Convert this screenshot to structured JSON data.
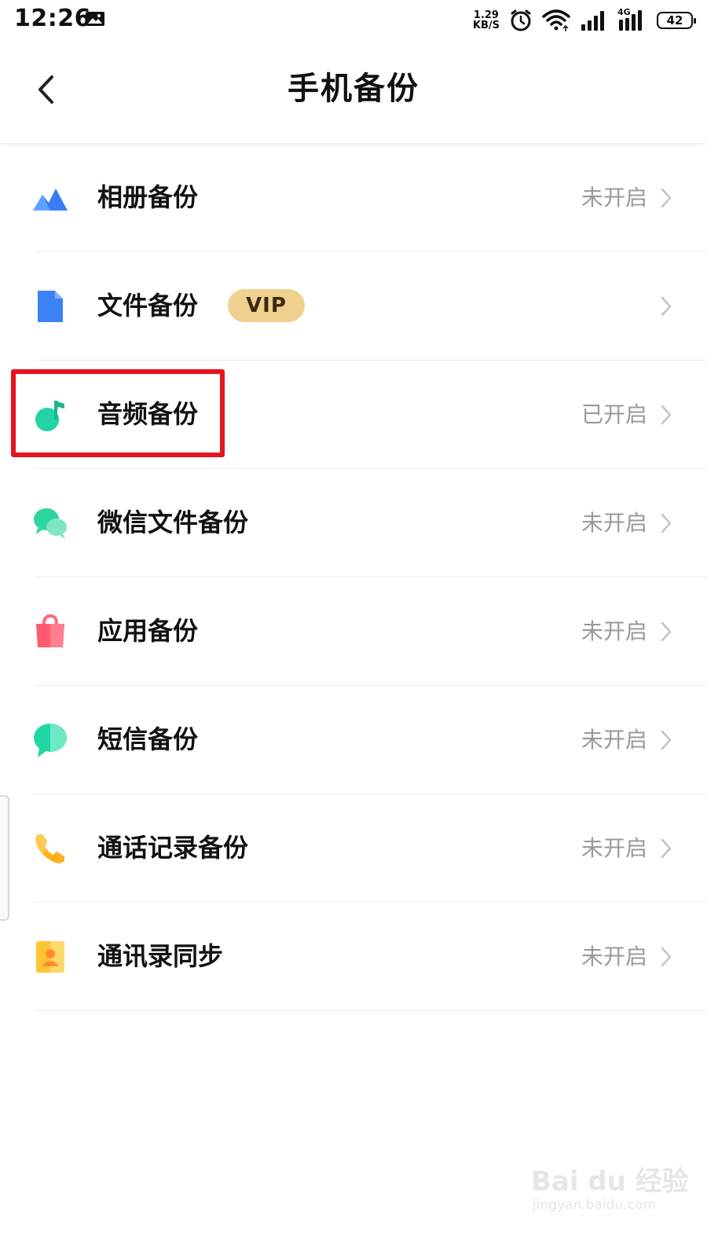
{
  "status_bar": {
    "time": "12:26",
    "net_speed_value": "1.29",
    "net_speed_unit": "KB/S",
    "signal_label": "4G",
    "battery": "42"
  },
  "header": {
    "title": "手机备份"
  },
  "list": {
    "items": [
      {
        "label": "相册备份",
        "status": "未开启",
        "icon": "photo-album-icon"
      },
      {
        "label": "文件备份",
        "status": "",
        "badge": "VIP",
        "icon": "file-icon"
      },
      {
        "label": "音频备份",
        "status": "已开启",
        "icon": "music-note-icon"
      },
      {
        "label": "微信文件备份",
        "status": "未开启",
        "icon": "wechat-icon"
      },
      {
        "label": "应用备份",
        "status": "未开启",
        "icon": "shopping-bag-icon"
      },
      {
        "label": "短信备份",
        "status": "未开启",
        "icon": "chat-bubble-icon"
      },
      {
        "label": "通话记录备份",
        "status": "未开启",
        "icon": "phone-icon"
      },
      {
        "label": "通讯录同步",
        "status": "未开启",
        "icon": "contact-card-icon"
      }
    ]
  },
  "watermark": {
    "brand": "Bai du 经验",
    "url": "jingyan.baidu.com"
  },
  "colors": {
    "highlight": "#e6141e",
    "vip_badge": "#efd08e",
    "status_text": "#9a9a9a"
  }
}
